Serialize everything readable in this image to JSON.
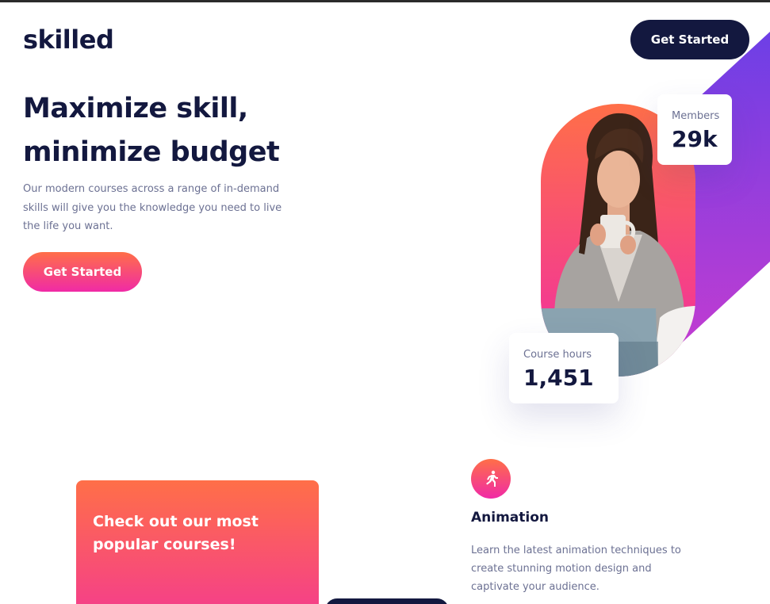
{
  "header": {
    "logo": "skilled",
    "cta_label": "Get Started"
  },
  "hero": {
    "title_line1": "Maximize skill,",
    "title_line2": "minimize budget",
    "description": "Our modern courses across a range of in-demand skills will give you the knowledge you need to live the life you want.",
    "cta_label": "Get Started"
  },
  "stats": {
    "members_label": "Members",
    "members_value": "29k",
    "hours_label": "Course hours",
    "hours_value": "1,451"
  },
  "promo": {
    "title": "Check out our most popular courses!"
  },
  "course": {
    "icon": "running-person-icon",
    "title": "Animation",
    "description": "Learn the latest animation techniques to create stunning motion design and captivate your audience."
  },
  "colors": {
    "navy": "#13183f",
    "gradient_start": "#ff6f48",
    "gradient_end": "#f02aa6",
    "purple_start": "#6d3fe6",
    "purple_end": "#c53cd0",
    "text_muted": "#6c7193"
  }
}
